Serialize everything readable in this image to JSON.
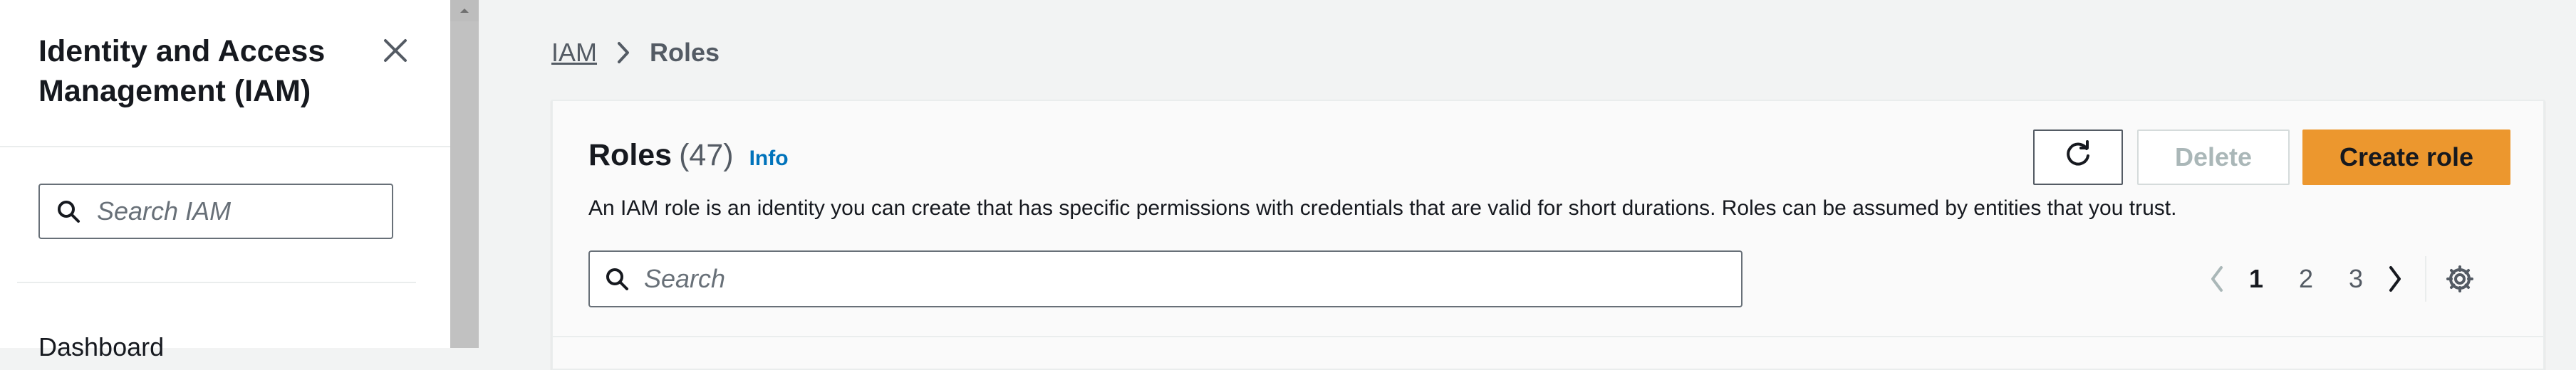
{
  "sidebar": {
    "title": "Identity and Access Management (IAM)",
    "close_icon": "close-icon",
    "search_placeholder": "Search IAM",
    "items": [
      {
        "label": "Dashboard"
      }
    ]
  },
  "breadcrumb": {
    "items": [
      {
        "label": "IAM",
        "link": true
      },
      {
        "label": "Roles",
        "link": false
      }
    ]
  },
  "roles_panel": {
    "title": "Roles",
    "count": "(47)",
    "info_label": "Info",
    "description": "An IAM role is an identity you can create that has specific permissions with credentials that are valid for short durations. Roles can be assumed by entities that you trust.",
    "refresh_icon": "refresh-icon",
    "delete_label": "Delete",
    "create_label": "Create role",
    "search_placeholder": "Search",
    "pagination": {
      "pages": [
        "1",
        "2",
        "3"
      ],
      "current": "1"
    }
  },
  "colors": {
    "accent": "#ec972e",
    "link": "#0073bb",
    "page_background": "#f2f3f3"
  }
}
